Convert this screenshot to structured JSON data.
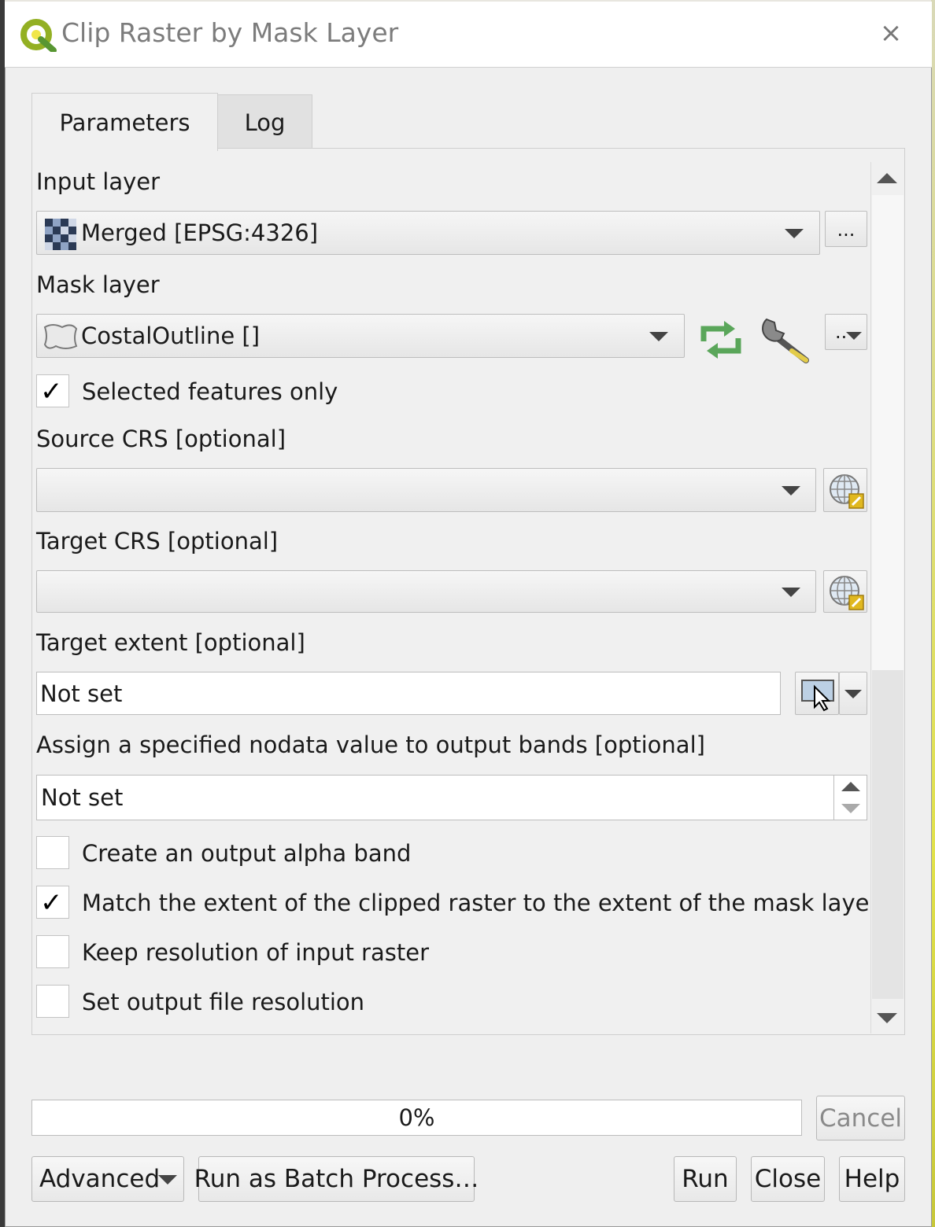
{
  "window": {
    "title": "Clip Raster by Mask Layer",
    "close_glyph": "×"
  },
  "tabs": [
    {
      "label": "Parameters",
      "active": true
    },
    {
      "label": "Log",
      "active": false
    }
  ],
  "params": {
    "input_layer": {
      "label": "Input layer",
      "value": "Merged [EPSG:4326]",
      "browse": "..."
    },
    "mask_layer": {
      "label": "Mask layer",
      "value": "CostalOutline []",
      "browse": "..",
      "selected_only": {
        "label": "Selected features only",
        "checked": true
      }
    },
    "source_crs": {
      "label": "Source CRS [optional]",
      "value": ""
    },
    "target_crs": {
      "label": "Target CRS [optional]",
      "value": ""
    },
    "target_extent": {
      "label": "Target extent [optional]",
      "value": "Not set"
    },
    "nodata": {
      "label": "Assign a specified nodata value to output bands [optional]",
      "value": "Not set"
    },
    "options": [
      {
        "label": "Create an output alpha band",
        "checked": false
      },
      {
        "label": "Match the extent of the clipped raster to the extent of the mask layer",
        "checked": true
      },
      {
        "label": "Keep resolution of input raster",
        "checked": false
      },
      {
        "label": "Set output file resolution",
        "checked": false
      }
    ]
  },
  "progress": {
    "text": "0%",
    "value": 0
  },
  "buttons": {
    "cancel": "Cancel",
    "advanced": "Advanced",
    "batch": "Run as Batch Process…",
    "run": "Run",
    "close": "Close",
    "help": "Help"
  },
  "icons": {
    "app": "qgis-logo-icon",
    "raster": "raster-layer-icon",
    "polygon": "polygon-layer-icon",
    "iterate": "iterate-icon",
    "settings": "wrench-icon",
    "crs": "crs-select-icon",
    "extent": "map-canvas-extent-icon"
  },
  "colors": {
    "accent_green": "#589632",
    "qgis_yellow": "#f0e64a"
  }
}
